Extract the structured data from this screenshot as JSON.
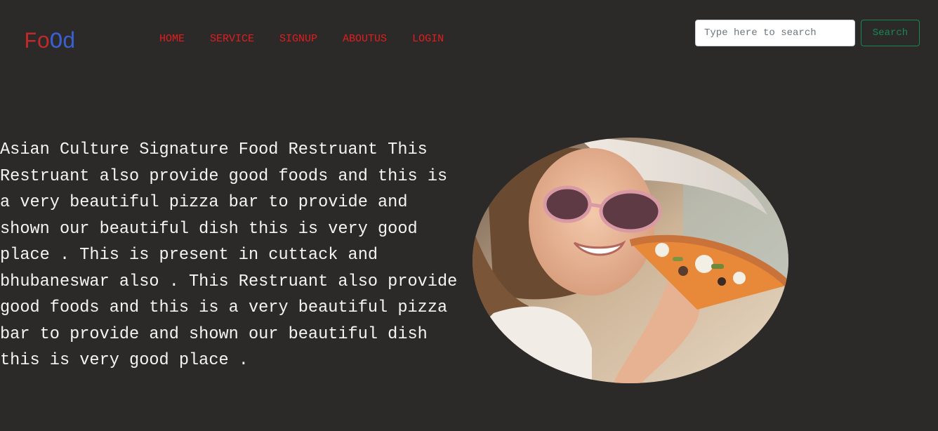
{
  "brand": {
    "part1": "Fo",
    "part2": "O",
    "part3": "d"
  },
  "nav": {
    "items": [
      {
        "label": "HOME"
      },
      {
        "label": "SERVICE"
      },
      {
        "label": "SIGNUP"
      },
      {
        "label": "ABOUTUS"
      },
      {
        "label": "LOGIN"
      }
    ]
  },
  "search": {
    "placeholder": "Type here to search",
    "value": "",
    "button_label": "Search"
  },
  "hero": {
    "text": "Asian Culture Signature Food Restruant This Restruant also provide good foods and this is a very beautiful pizza bar to provide and shown our beautiful dish this is very good place . This is present in cuttack and bhubaneswar also . This Restruant also provide good foods and this is a very beautiful pizza bar to provide and shown our beautiful dish this is very good place ."
  },
  "colors": {
    "background": "#2c2a29",
    "nav_link": "#e31d1d",
    "logo_red": "#c0282a",
    "logo_blue": "#3a5fd0",
    "search_button": "#198754"
  }
}
